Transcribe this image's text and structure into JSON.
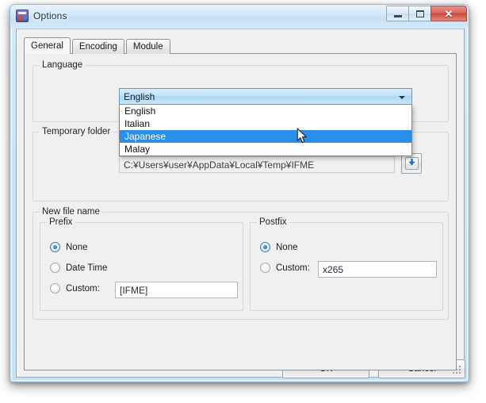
{
  "window": {
    "title": "Options",
    "icon": "options-app-icon",
    "controls": {
      "minimize": "minimize-button",
      "maximize": "maximize-button",
      "close_glyph": "✕"
    }
  },
  "tabs": [
    {
      "label": "General",
      "active": true
    },
    {
      "label": "Encoding",
      "active": false
    },
    {
      "label": "Module",
      "active": false
    }
  ],
  "language_group": {
    "legend": "Language",
    "combobox": {
      "value": "English",
      "expanded": true,
      "options": [
        {
          "label": "English",
          "selected": false
        },
        {
          "label": "Italian",
          "selected": false
        },
        {
          "label": "Japanese",
          "selected": true
        },
        {
          "label": "Malay",
          "selected": false
        }
      ]
    }
  },
  "temp_group": {
    "legend": "Temporary folder",
    "path_value": "C:¥Users¥user¥AppData¥Local¥Temp¥IFME",
    "browse_title": "browse-folder"
  },
  "newname_group": {
    "legend": "New file name",
    "prefix": {
      "legend": "Prefix",
      "options": [
        {
          "label": "None",
          "checked": true
        },
        {
          "label": "Date Time",
          "checked": false
        },
        {
          "label": "Custom:",
          "checked": false
        }
      ],
      "custom_value": "[IFME]"
    },
    "postfix": {
      "legend": "Postfix",
      "options": [
        {
          "label": "None",
          "checked": true
        },
        {
          "label": "Custom:",
          "checked": false
        }
      ],
      "custom_value": "x265"
    }
  },
  "buttons": {
    "ok": "OK",
    "cancel": "Cancel"
  },
  "colors": {
    "highlight": "#2a8fe8",
    "titlebar": "#cfe5f6",
    "close_red": "#c9493c",
    "dialog_bg": "#f0f0f0"
  }
}
